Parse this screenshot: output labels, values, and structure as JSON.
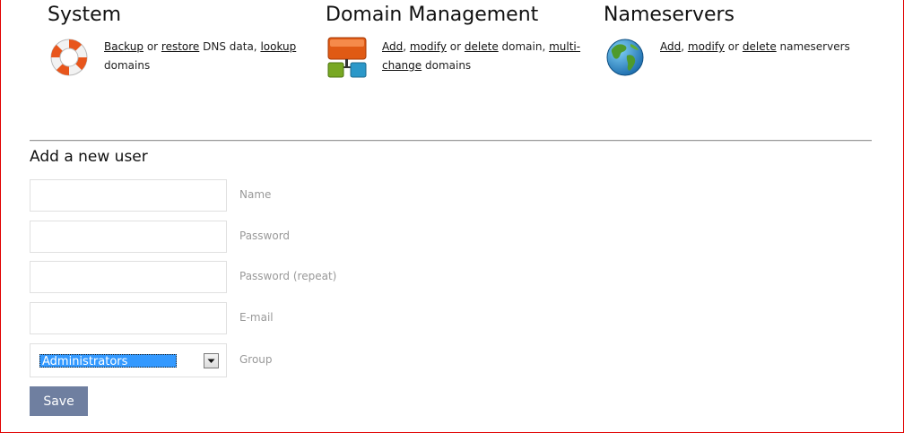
{
  "sections": {
    "system": {
      "title": "System",
      "links": {
        "backup": "Backup",
        "restore": "restore",
        "lookup": "lookup"
      },
      "text": {
        "or": " or ",
        "dns": " DNS data, ",
        "domains": "domains"
      }
    },
    "domain": {
      "title": "Domain Management",
      "links": {
        "add": "Add",
        "modify": "modify",
        "delete": "delete",
        "multi": "multi-",
        "change": "change"
      },
      "text": {
        "comma": ", ",
        "or": " or ",
        "domain": " domain, ",
        "domains": " domains"
      }
    },
    "nameservers": {
      "title": "Nameservers",
      "links": {
        "add": "Add",
        "modify": "modify",
        "delete": "delete"
      },
      "text": {
        "comma": ", ",
        "or": " or ",
        "ns": " nameservers"
      }
    }
  },
  "form": {
    "title": "Add a new user",
    "fields": {
      "name": {
        "label": "Name",
        "value": ""
      },
      "password": {
        "label": "Password",
        "value": ""
      },
      "password_repeat": {
        "label": "Password (repeat)",
        "value": ""
      },
      "email": {
        "label": "E-mail",
        "value": ""
      }
    },
    "group": {
      "label": "Group",
      "selected": "Administrators"
    },
    "save_label": "Save"
  },
  "icons": {
    "system": "lifebuoy-icon",
    "domain": "network-tree-icon",
    "nameservers": "globe-icon",
    "select": "dropdown-arrow-icon"
  },
  "colors": {
    "accent_button": "#6f7fa0",
    "selection": "#3399ff",
    "frame_border": "#e00000"
  }
}
